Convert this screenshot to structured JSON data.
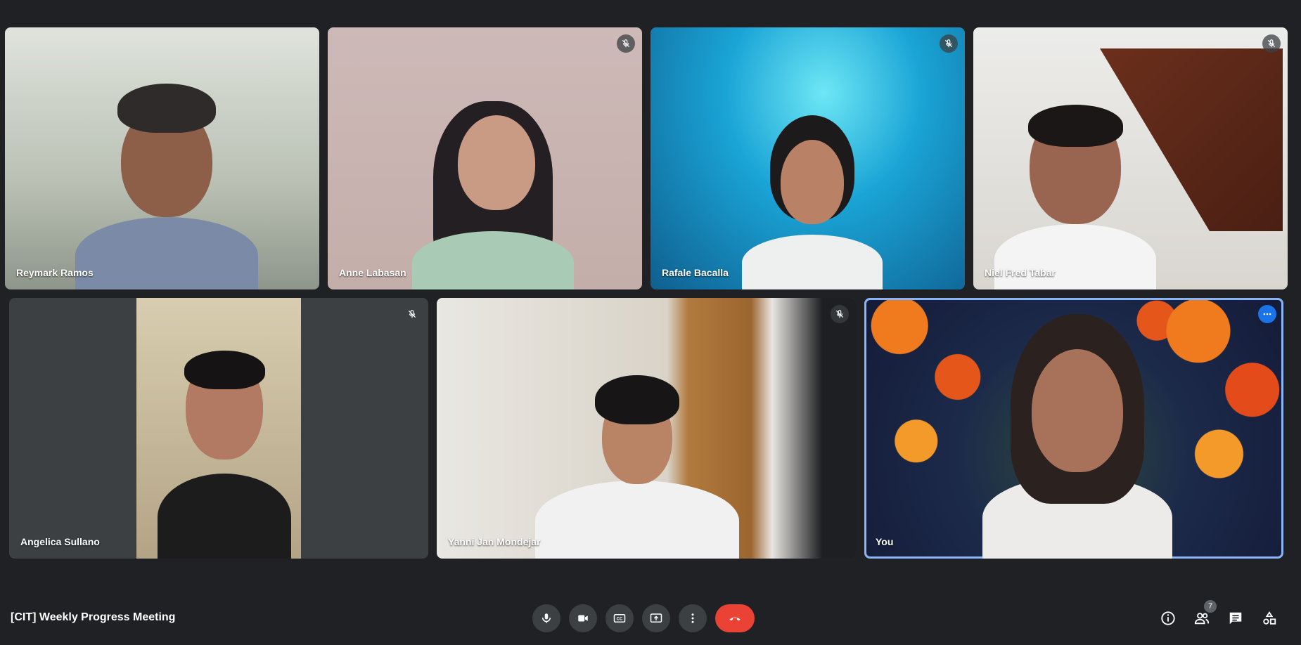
{
  "meeting": {
    "title": "[CIT] Weekly Progress Meeting"
  },
  "participants": [
    {
      "name": "Reymark Ramos"
    },
    {
      "name": "Anne Labasan"
    },
    {
      "name": "Rafale Bacalla"
    },
    {
      "name": "Niel Fred Tabar"
    },
    {
      "name": "Angelica Sullano"
    },
    {
      "name": "Yanni Jan Mondejar"
    },
    {
      "name": "You"
    }
  ],
  "people_badge": {
    "count": "7"
  },
  "icons": {
    "mic": "microphone-icon",
    "camera": "camera-icon",
    "captions": "closed-captions-icon",
    "present": "present-screen-icon",
    "more": "more-options-icon",
    "end": "end-call-icon",
    "info": "info-icon",
    "people": "people-icon",
    "chat": "chat-icon",
    "activities": "activities-icon"
  },
  "colors": {
    "background": "#202124",
    "end_call": "#ea4335",
    "accent": "#8ab4f8"
  }
}
